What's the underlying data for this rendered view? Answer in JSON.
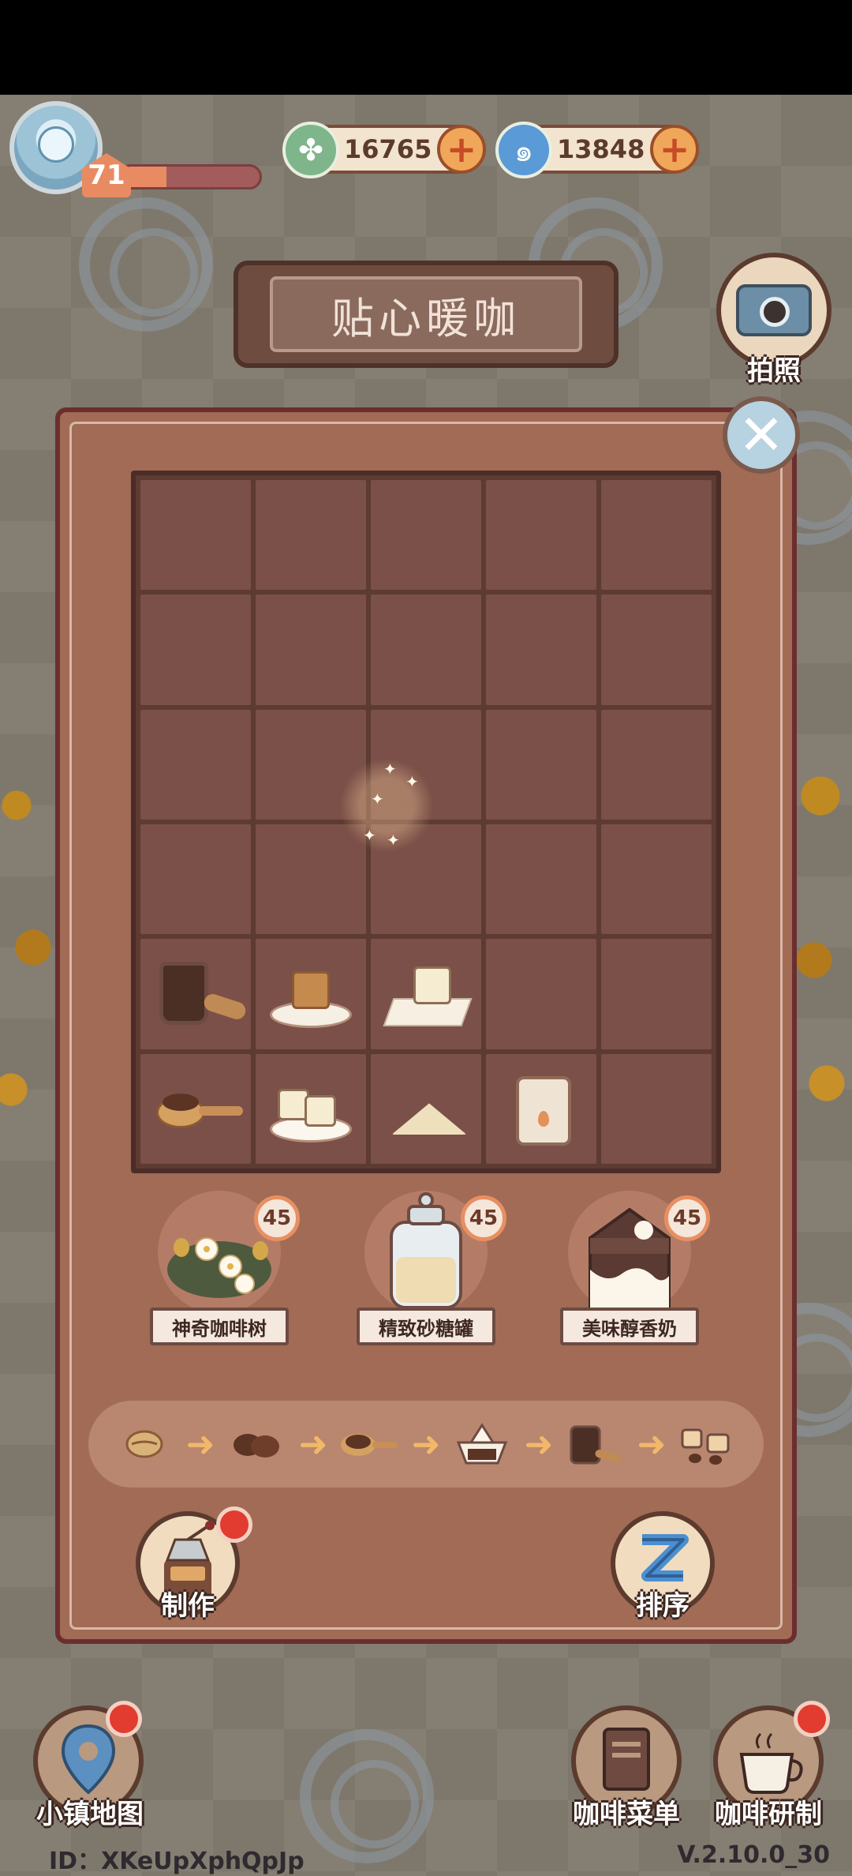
{
  "player": {
    "level": "71",
    "xp_progress": 0.33
  },
  "currencies": [
    {
      "name": "leaf",
      "value": "16765",
      "icon": "clover-icon",
      "color": "#7fb58a"
    },
    {
      "name": "swirl",
      "value": "13848",
      "icon": "swirl-icon",
      "color": "#5a9ad6"
    }
  ],
  "shop_sign": "贴心暖咖",
  "camera": {
    "label": "拍照"
  },
  "inventory": {
    "columns": 5,
    "rows": 6,
    "items": [
      {
        "row": 5,
        "col": 1,
        "name": "coffee-pitcher"
      },
      {
        "row": 5,
        "col": 2,
        "name": "brown-sugar-cube"
      },
      {
        "row": 5,
        "col": 3,
        "name": "sugar-cube-on-napkin"
      },
      {
        "row": 6,
        "col": 1,
        "name": "ground-coffee-spoon"
      },
      {
        "row": 6,
        "col": 2,
        "name": "sugar-cubes-plate"
      },
      {
        "row": 6,
        "col": 3,
        "name": "sugar-powder-pile"
      },
      {
        "row": 6,
        "col": 4,
        "name": "milk-powder-bag"
      }
    ]
  },
  "sources": [
    {
      "label": "神奇咖啡树",
      "count": "45",
      "icon": "coffee-tree-icon"
    },
    {
      "label": "精致砂糖罐",
      "count": "45",
      "icon": "sugar-jar-icon"
    },
    {
      "label": "美味醇香奶",
      "count": "45",
      "icon": "milk-carton-icon"
    }
  ],
  "process_chain": [
    "coffee-bean-icon",
    "roasted-beans-icon",
    "ground-coffee-icon",
    "drip-filter-icon",
    "pitcher-icon",
    "espresso-cups-icon"
  ],
  "actions": {
    "make": "制作",
    "sort": "排序"
  },
  "nav": {
    "map": "小镇地图",
    "menu": "咖啡菜单",
    "research": "咖啡研制"
  },
  "footer": {
    "id": "ID：XKeUpXphQpJp",
    "version": "V.2.10.0_30"
  }
}
